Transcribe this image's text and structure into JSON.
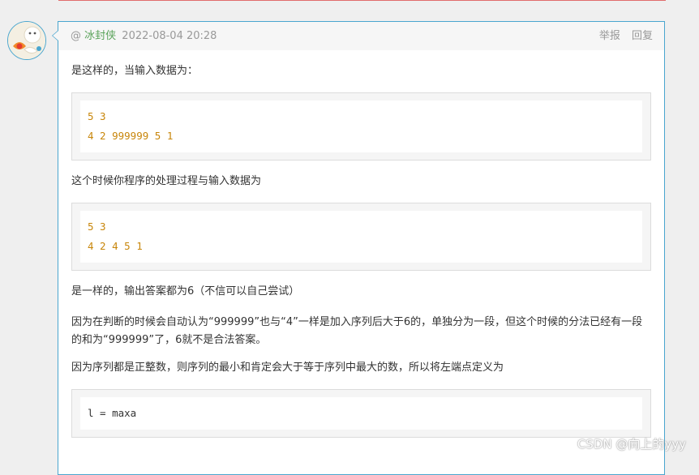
{
  "comment": {
    "prefix": "@",
    "user": "冰封侠",
    "time": "2022-08-04 20:28",
    "actions": {
      "report": "举报",
      "reply": "回复"
    },
    "p1": "是这样的，当输入数据为：",
    "code1": [
      "5 3",
      "4 2 999999 5 1"
    ],
    "p2": "这个时候你程序的处理过程与输入数据为",
    "code2": [
      "5 3",
      "4 2 4 5 1"
    ],
    "p3": "是一样的，输出答案都为6（不信可以自己尝试）",
    "p4": "因为在判断的时候会自动认为“999999”也与“4”一样是加入序列后大于6的，单独分为一段，但这个时候的分法已经有一段的和为“999999”了，6就不是合法答案。",
    "p5": "因为序列都是正整数，则序列的最小和肯定会大于等于序列中最大的数，所以将左端点定义为",
    "code3": [
      "l = maxa"
    ]
  },
  "watermark": "CSDN @向上的yyy",
  "colors": {
    "accent_border": "#4aa6cf",
    "username": "#5aa35a",
    "code_text": "#c8860a",
    "top_rule": "#e06c6c"
  },
  "icons": {
    "avatar": "cartoon-avatar-icon"
  }
}
